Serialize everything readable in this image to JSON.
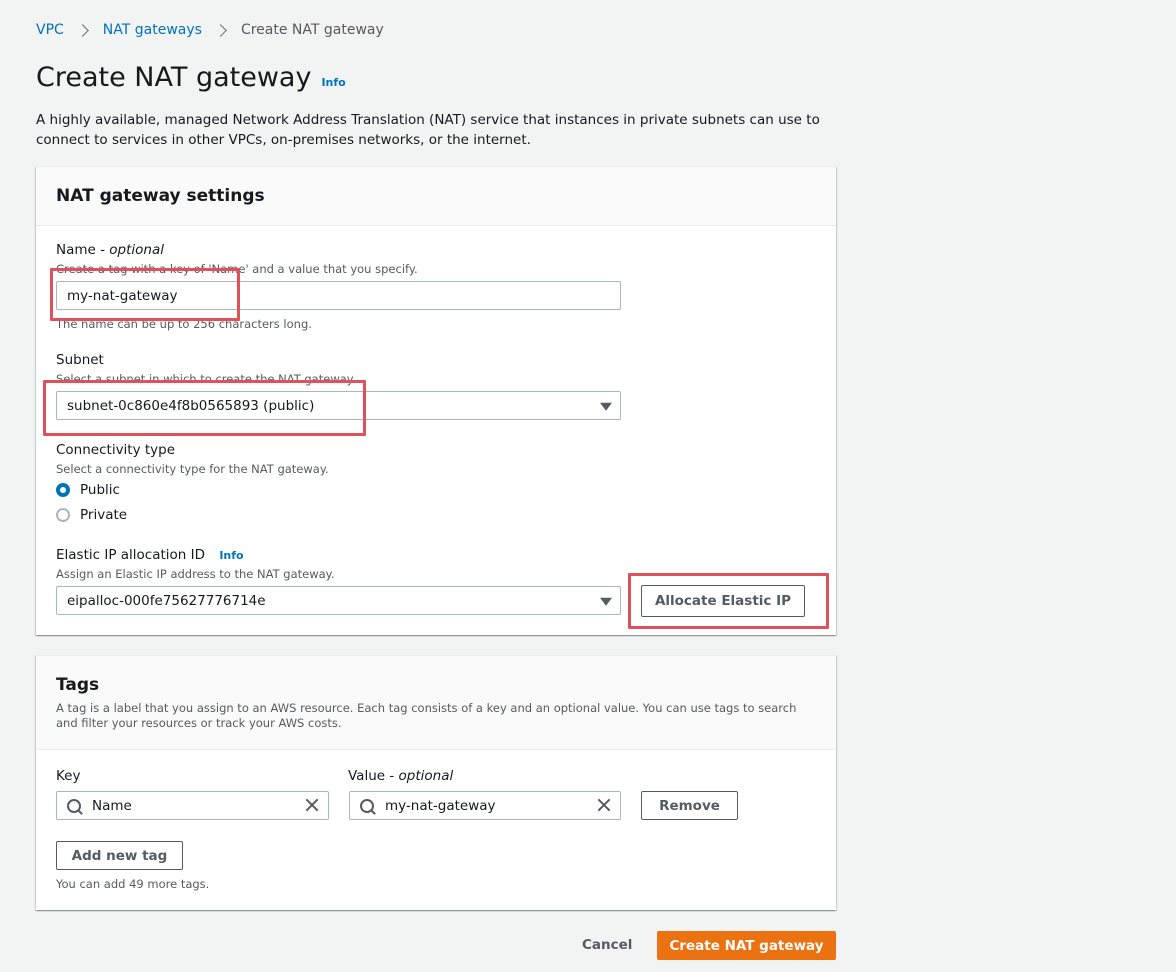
{
  "breadcrumb": {
    "items": [
      "VPC",
      "NAT gateways"
    ],
    "current": "Create NAT gateway"
  },
  "page": {
    "title": "Create NAT gateway",
    "info": "Info",
    "description": "A highly available, managed Network Address Translation (NAT) service that instances in private subnets can use to connect to services in other VPCs, on-premises networks, or the internet."
  },
  "settings": {
    "title": "NAT gateway settings",
    "name": {
      "label": "Name - ",
      "label_optional": "optional",
      "description": "Create a tag with a key of 'Name' and a value that you specify.",
      "value": "my-nat-gateway",
      "constraint": "The name can be up to 256 characters long."
    },
    "subnet": {
      "label": "Subnet",
      "description": "Select a subnet in which to create the NAT gateway.",
      "value": "subnet-0c860e4f8b0565893 (public)"
    },
    "connectivity": {
      "label": "Connectivity type",
      "description": "Select a connectivity type for the NAT gateway.",
      "options": [
        "Public",
        "Private"
      ],
      "selected": "Public"
    },
    "eip": {
      "label": "Elastic IP allocation ID",
      "info": "Info",
      "description": "Assign an Elastic IP address to the NAT gateway.",
      "value": "eipalloc-000fe75627776714e",
      "allocate_button": "Allocate Elastic IP"
    }
  },
  "tags": {
    "title": "Tags",
    "description": "A tag is a label that you assign to an AWS resource. Each tag consists of a key and an optional value. You can use tags to search and filter your resources or track your AWS costs.",
    "key_label": "Key",
    "value_label": "Value - ",
    "value_label_optional": "optional",
    "rows": [
      {
        "key": "Name",
        "value": "my-nat-gateway"
      }
    ],
    "remove_button": "Remove",
    "add_button": "Add new tag",
    "limit_text": "You can add 49 more tags."
  },
  "footer": {
    "cancel": "Cancel",
    "create": "Create NAT gateway"
  },
  "colors": {
    "link": "#0073bb",
    "primary": "#ec7211",
    "highlight": "#e0515b"
  }
}
